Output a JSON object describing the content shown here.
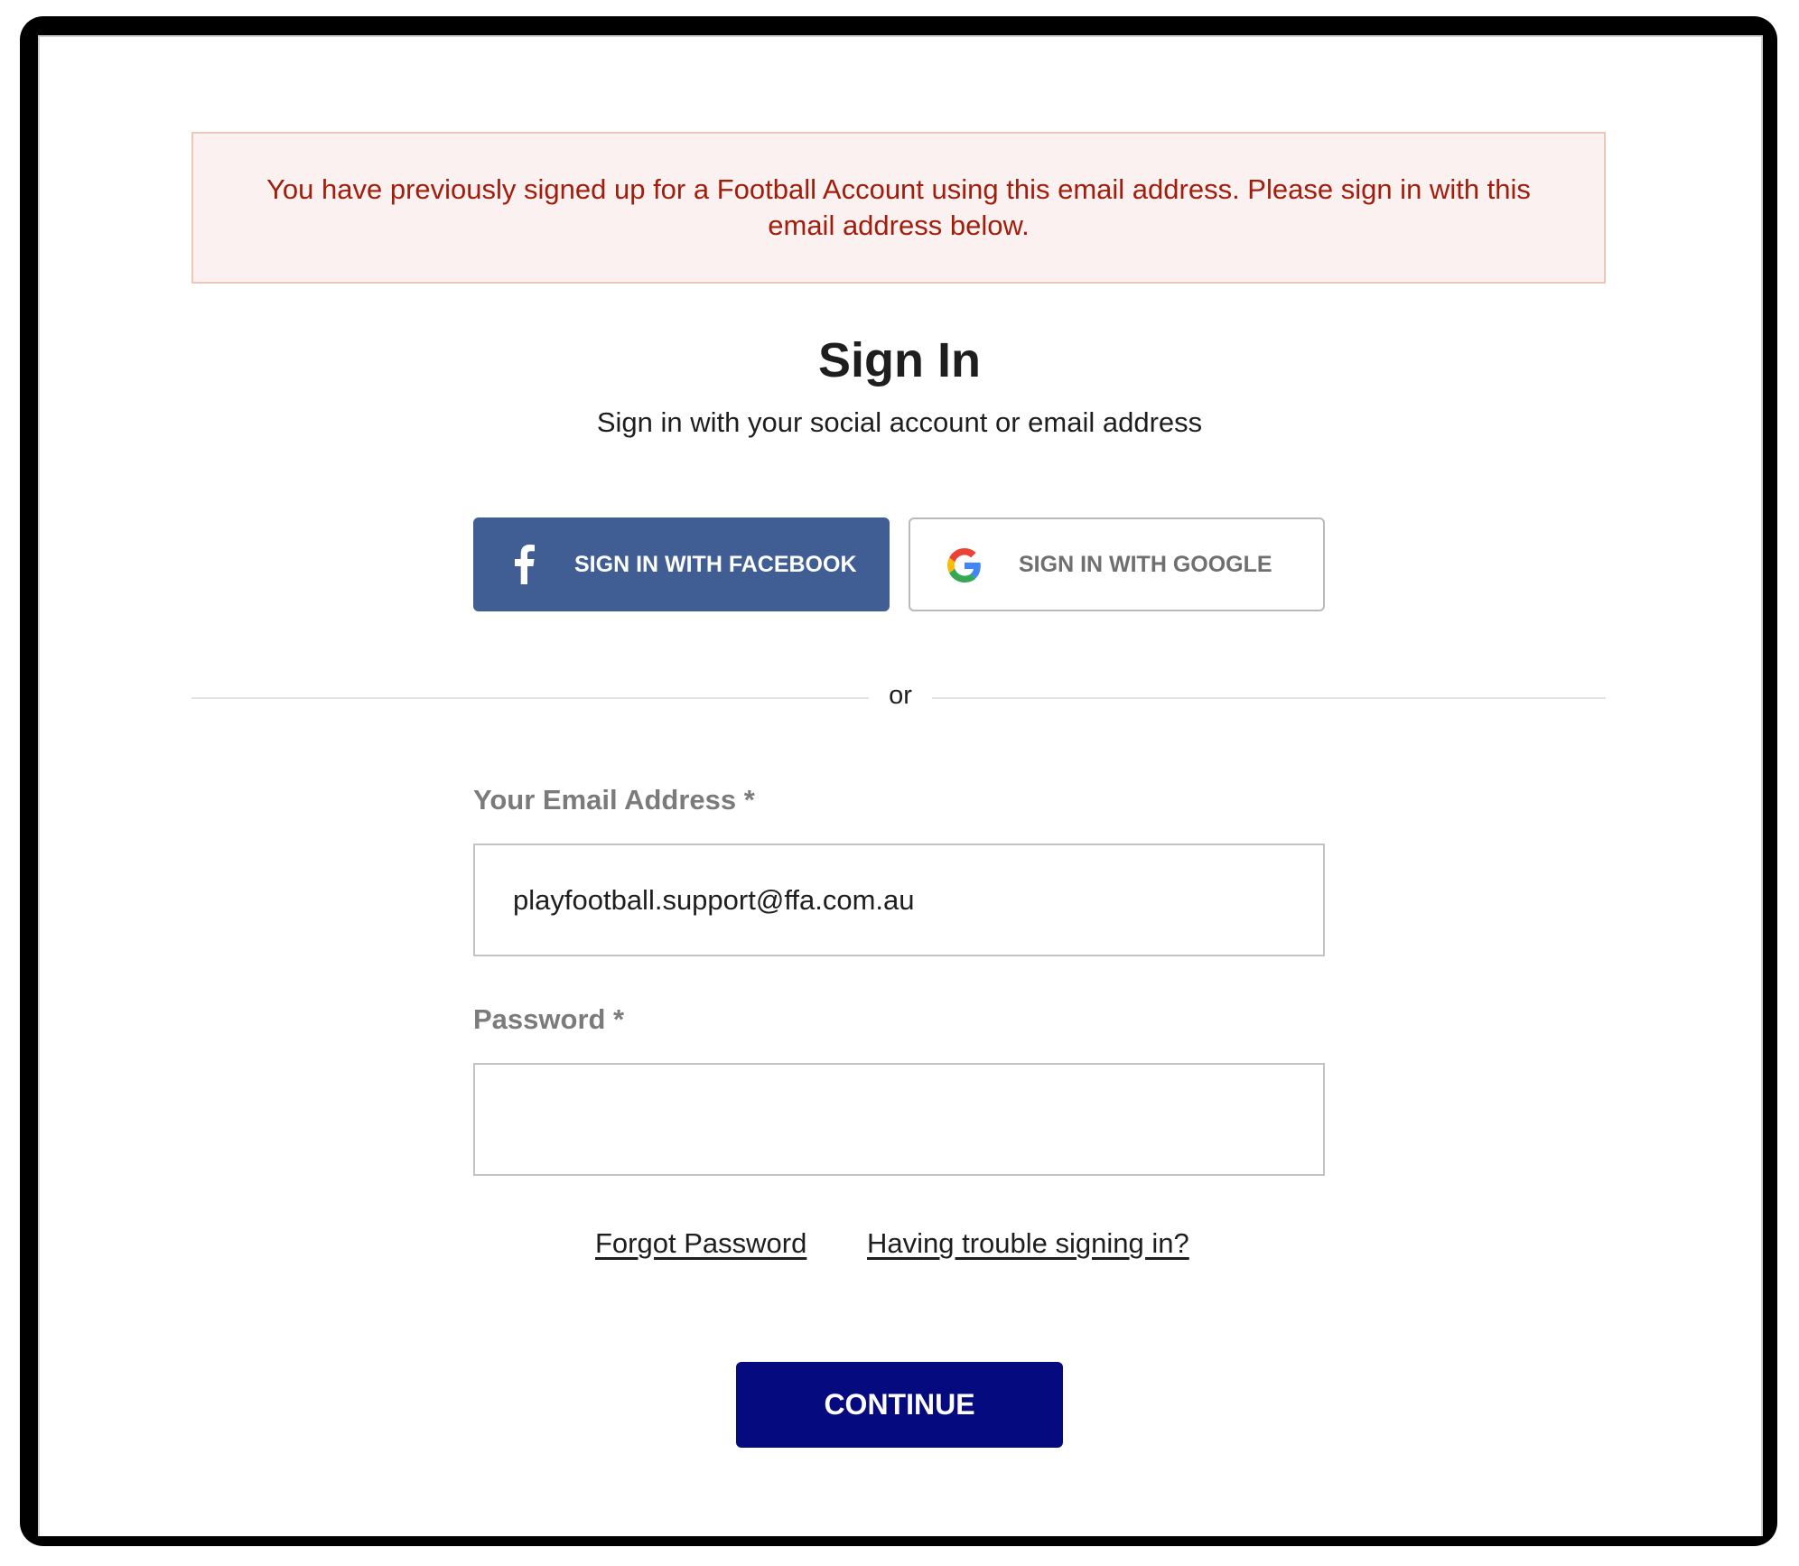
{
  "alert": {
    "message": "You have previously signed up for a Football Account using this email address. Please sign in with this email address below."
  },
  "header": {
    "title": "Sign In",
    "subtitle": "Sign in with your social account or email address"
  },
  "social": {
    "facebook_label": "SIGN IN WITH FACEBOOK",
    "google_label": "SIGN IN WITH GOOGLE",
    "facebook_color": "#415e94"
  },
  "divider": {
    "text": "or"
  },
  "form": {
    "email_label": "Your Email Address *",
    "email_value": "playfootball.support@ffa.com.au",
    "password_label": "Password *",
    "password_value": ""
  },
  "links": {
    "forgot": "Forgot Password",
    "trouble": "Having trouble signing in?"
  },
  "actions": {
    "continue_label": "CONTINUE",
    "continue_color": "#050a7e"
  },
  "colors": {
    "alert_text": "#a11d0c",
    "alert_bg": "#fbf1f0",
    "alert_border": "#efc7b8"
  }
}
